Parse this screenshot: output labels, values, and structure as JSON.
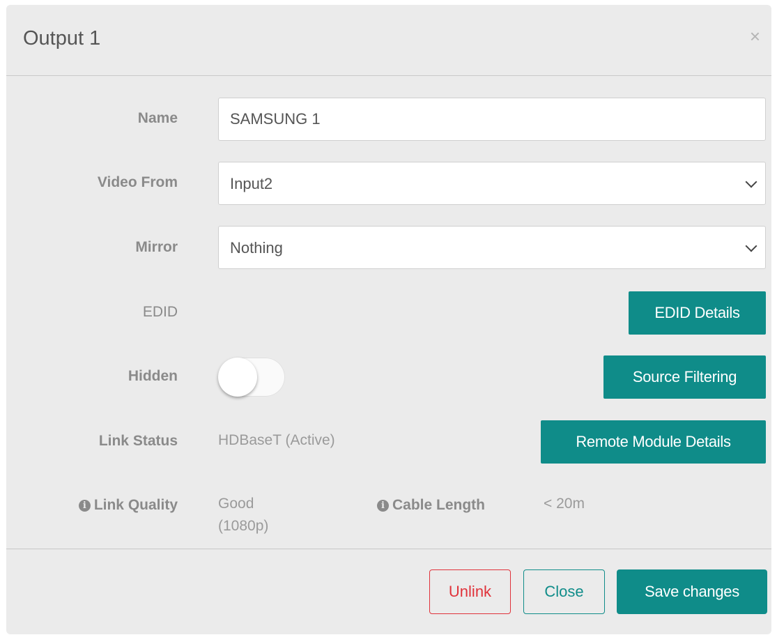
{
  "dialog": {
    "title": "Output 1",
    "close_symbol": "×"
  },
  "form": {
    "name": {
      "label": "Name",
      "value": "SAMSUNG 1"
    },
    "video_from": {
      "label": "Video From",
      "selected": "Input2"
    },
    "mirror": {
      "label": "Mirror",
      "selected": "Nothing"
    },
    "edid": {
      "label": "EDID",
      "button": "EDID Details"
    },
    "hidden": {
      "label": "Hidden",
      "toggled": false,
      "button": "Source Filtering"
    },
    "link_status": {
      "label": "Link Status",
      "value": "HDBaseT (Active)",
      "button": "Remote Module Details"
    },
    "link_quality": {
      "label": "Link Quality",
      "value_line1": "Good",
      "value_line2": "(1080p)"
    },
    "cable_length": {
      "label": "Cable Length",
      "value": "< 20m"
    }
  },
  "footer": {
    "unlink_label": "Unlink",
    "close_label": "Close",
    "save_label": "Save changes"
  },
  "colors": {
    "accent": "#0f8c89",
    "danger": "#e0323a",
    "background": "#ebebeb"
  },
  "icons": {
    "info": "info-circle-icon",
    "dropdown": "chevron-down-icon",
    "dismiss": "close-icon"
  }
}
